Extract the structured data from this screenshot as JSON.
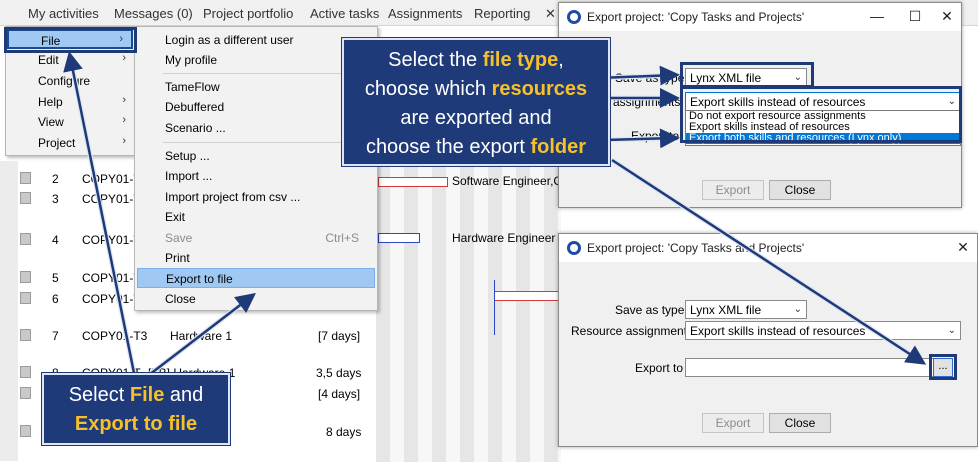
{
  "menubar": [
    "My activities",
    "Messages (0)",
    "Project portfolio",
    "Active tasks",
    "Assignments",
    "Reporting",
    "✕"
  ],
  "file_menu": [
    {
      "label": "File",
      "arrow": "›"
    },
    {
      "label": "Edit",
      "arrow": "›"
    },
    {
      "label": "Configure",
      "arrow": ""
    },
    {
      "label": "Help",
      "arrow": "›"
    },
    {
      "label": "View",
      "arrow": "›"
    },
    {
      "label": "Project",
      "arrow": "›"
    }
  ],
  "file_submenu": [
    {
      "label": "Login as a different user",
      "shortcut": ""
    },
    {
      "label": "My profile",
      "shortcut": ""
    },
    {
      "label": "TameFlow",
      "shortcut": ""
    },
    {
      "label": "Debuffered",
      "shortcut": ""
    },
    {
      "label": "Scenario ...",
      "shortcut": ""
    },
    {
      "label": "Setup ...",
      "shortcut": ""
    },
    {
      "label": "Import ...",
      "shortcut": ""
    },
    {
      "label": "Import project from csv ...",
      "shortcut": ""
    },
    {
      "label": "Exit",
      "shortcut": ""
    },
    {
      "label": "Save",
      "shortcut": "Ctrl+S"
    },
    {
      "label": "Print",
      "shortcut": ""
    },
    {
      "label": "Export to file",
      "shortcut": ""
    },
    {
      "label": "Close",
      "shortcut": ""
    }
  ],
  "grid_rows": [
    {
      "num": "2",
      "id": "COPY01-T",
      "res": "",
      "dur": ""
    },
    {
      "num": "3",
      "id": "COPY01-T",
      "res": "",
      "dur": ""
    },
    {
      "num": "4",
      "id": "COPY01-T1",
      "res": "",
      "dur": ""
    },
    {
      "num": "5",
      "id": "COPY01-T",
      "res": "",
      "dur": ""
    },
    {
      "num": "6",
      "id": "COPY01-T",
      "res": "",
      "dur": ""
    },
    {
      "num": "7",
      "id": "COPY01-T3",
      "res": "Hardware 1",
      "dur": "[7 days]"
    },
    {
      "num": "8",
      "id": "COPY01-T",
      "res": "[FB] Hardware 1",
      "dur": "3,5 days"
    },
    {
      "num": "",
      "id": "",
      "res": "",
      "dur": "[4 days]"
    },
    {
      "num": "",
      "id": "",
      "res": "",
      "dur": "8 days"
    }
  ],
  "gantt_labels": [
    "Software Engineer,C",
    "Hardware Engineer"
  ],
  "dialog_top": {
    "title": "Export project: 'Copy Tasks and Projects'",
    "minimize": "—",
    "maximize": "☐",
    "close": "✕",
    "save_as_type_label": "Save as type",
    "save_as_type_value": "Lynx XML file",
    "resource_label": "assignments",
    "resource_value": "Export skills instead of resources",
    "options": [
      "Do not export resource assignments",
      "Export skills instead of resources",
      "Export both skills and resources (Lynx only)"
    ],
    "export_to_label": "Export to",
    "export_button": "Export",
    "close_button": "Close"
  },
  "dialog_bottom": {
    "title": "Export project: 'Copy Tasks and Projects'",
    "close": "✕",
    "save_as_type_label": "Save as type",
    "save_as_type_value": "Lynx XML file",
    "resource_label": "Resource assignments",
    "resource_value": "Export skills instead of resources",
    "export_to_label": "Export to",
    "browse_button": "...",
    "export_button": "Export",
    "close_button": "Close"
  },
  "callout_top": {
    "l1a": "Select the ",
    "l1b": "file type",
    "l1c": ",",
    "l2a": "choose which ",
    "l2b": "resources",
    "l3": "are exported and",
    "l4a": "choose the export ",
    "l4b": "folder"
  },
  "callout_bottom": {
    "l1a": "Select ",
    "l1b": "File",
    "l1c": " and",
    "l2": "Export to file"
  },
  "colors": {
    "accent": "#1f3a78",
    "highlight": "#f5c02a",
    "selection": "#9fc9f2"
  }
}
